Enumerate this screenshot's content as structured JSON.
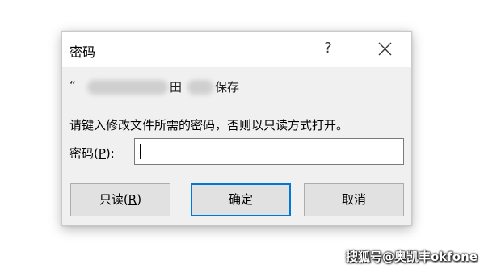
{
  "dialog": {
    "title": "密码",
    "help_glyph": "?",
    "close_icon": "close-icon",
    "filename": {
      "prefix": "“",
      "char_1": "田",
      "suffix": "保存"
    },
    "prompt": "请键入修改文件所需的密码，否则以只读方式打开。",
    "password_label": {
      "before": "密码(",
      "accelerator": "P",
      "after": "):"
    },
    "password_value": "",
    "buttons": {
      "readonly": {
        "before": "只读(",
        "accelerator": "R",
        "after": ")"
      },
      "ok": "确定",
      "cancel": "取消"
    },
    "accent_color": "#0078d7"
  },
  "watermark": "搜狐号@奥凯丰okfone"
}
